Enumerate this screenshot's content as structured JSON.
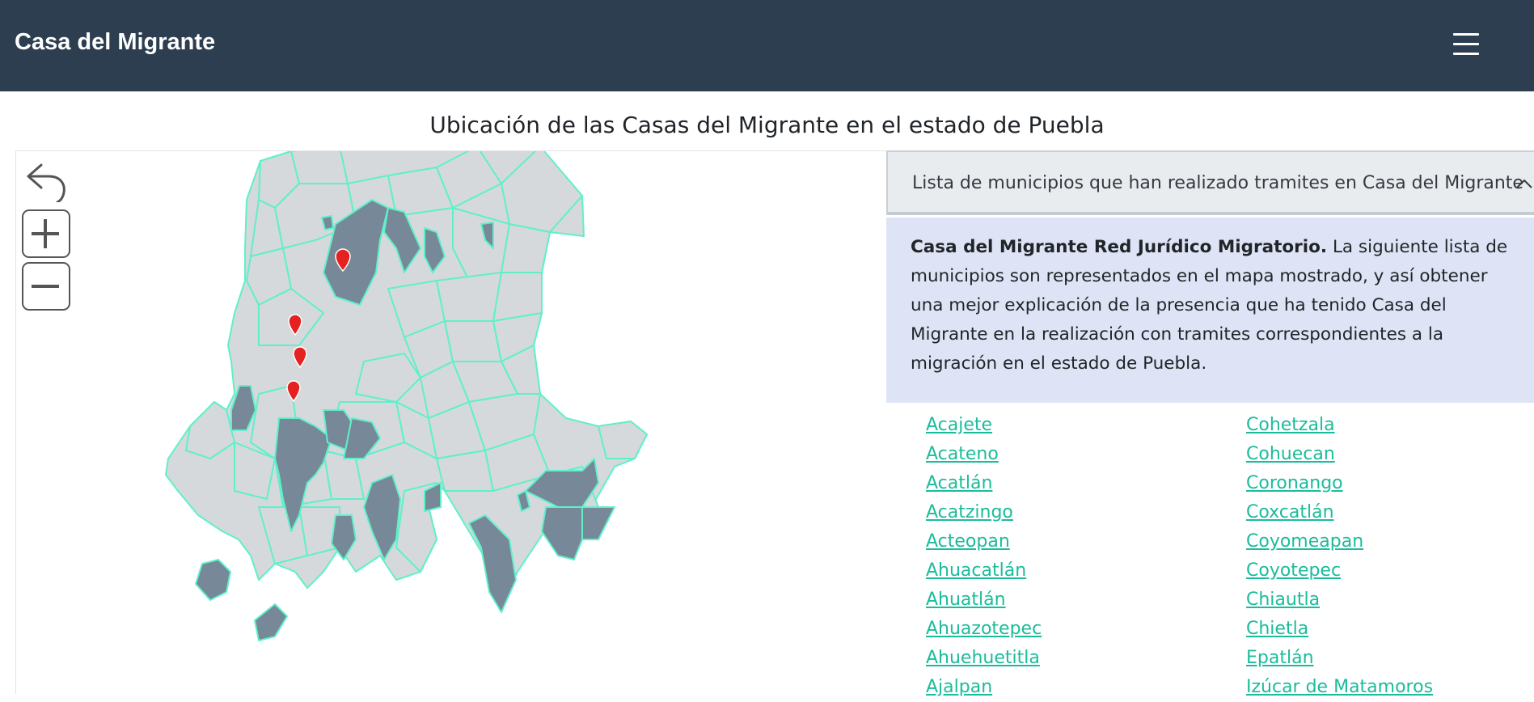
{
  "navbar": {
    "brand": "Casa del Migrante",
    "menu_icon": "hamburger-icon"
  },
  "page": {
    "title": "Ubicación de las Casas del Migrante en el estado de Puebla"
  },
  "map": {
    "controls": [
      {
        "name": "back-arrow-icon"
      },
      {
        "name": "zoom-in-icon"
      },
      {
        "name": "zoom-out-icon"
      }
    ],
    "colors": {
      "municipality_fill": "#d5d9dc",
      "highlighted_fill": "#778899",
      "border": "#5ff0c9",
      "marker": "#e52121"
    },
    "markers": 4
  },
  "accordion": {
    "title": "Lista de municipios que han realizado tramites en Casa del Migrante",
    "chevron_icon": "chevron-up-icon",
    "intro_bold": "Casa del Migrante Red Jurídico Migratorio.",
    "intro_text": " La siguiente lista de municipios son representados en el mapa mostrado, y así obtener una mejor explicación de la presencia que ha tenido Casa del Migrante en la realización con tramites correspondientes a la migración en el estado de Puebla."
  },
  "municipios": {
    "col1": [
      "Acajete",
      "Acateno",
      "Acatlán",
      "Acatzingo",
      "Acteopan",
      "Ahuacatlán",
      "Ahuatlán",
      "Ahuazotepec",
      "Ahuehuetitla",
      "Ajalpan"
    ],
    "col2": [
      "Cohetzala",
      "Cohuecan",
      "Coronango",
      "Coxcatlán",
      "Coyomeapan",
      "Coyotepec",
      "Chiautla",
      "Chietla",
      "Epatlán",
      "Izúcar de Matamoros"
    ]
  },
  "colors": {
    "navbar": "#2c3e50",
    "link": "#1bbc9b",
    "panel_body": "#dee4f5"
  }
}
